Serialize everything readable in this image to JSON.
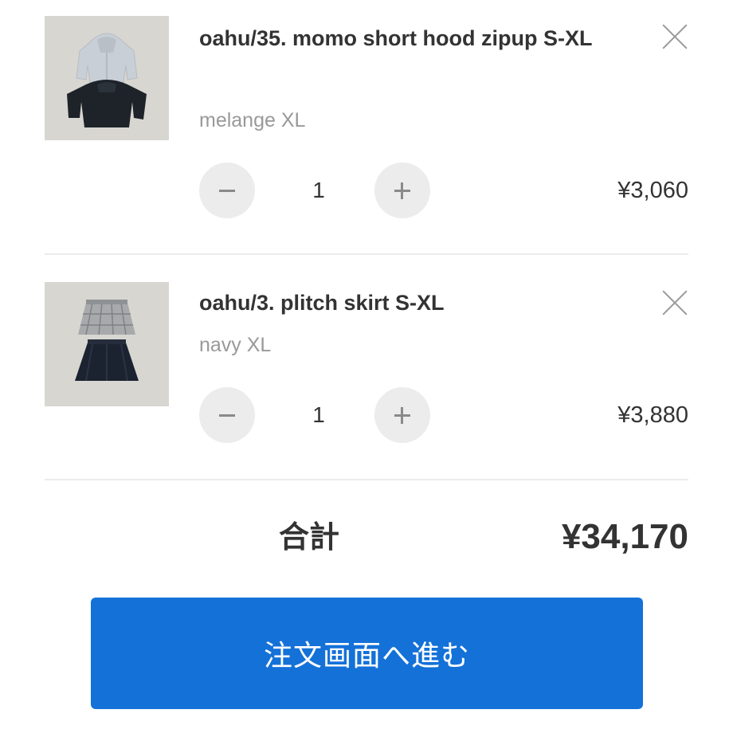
{
  "cart": {
    "items": [
      {
        "title": "oahu/35. momo short hood zipup S-XL",
        "variant": "melange XL",
        "quantity": "1",
        "price": "¥3,060",
        "image_icon": "product-photo-hoodie"
      },
      {
        "title": "oahu/3. plitch skirt S-XL",
        "variant": "navy XL",
        "quantity": "1",
        "price": "¥3,880",
        "image_icon": "product-photo-skirt"
      }
    ],
    "total_label": "合計",
    "total_value": "¥34,170",
    "checkout_label": "注文画面へ進む"
  },
  "colors": {
    "accent": "#1471d8",
    "button_bg": "#ececec",
    "text": "#333333",
    "muted": "#999999"
  }
}
